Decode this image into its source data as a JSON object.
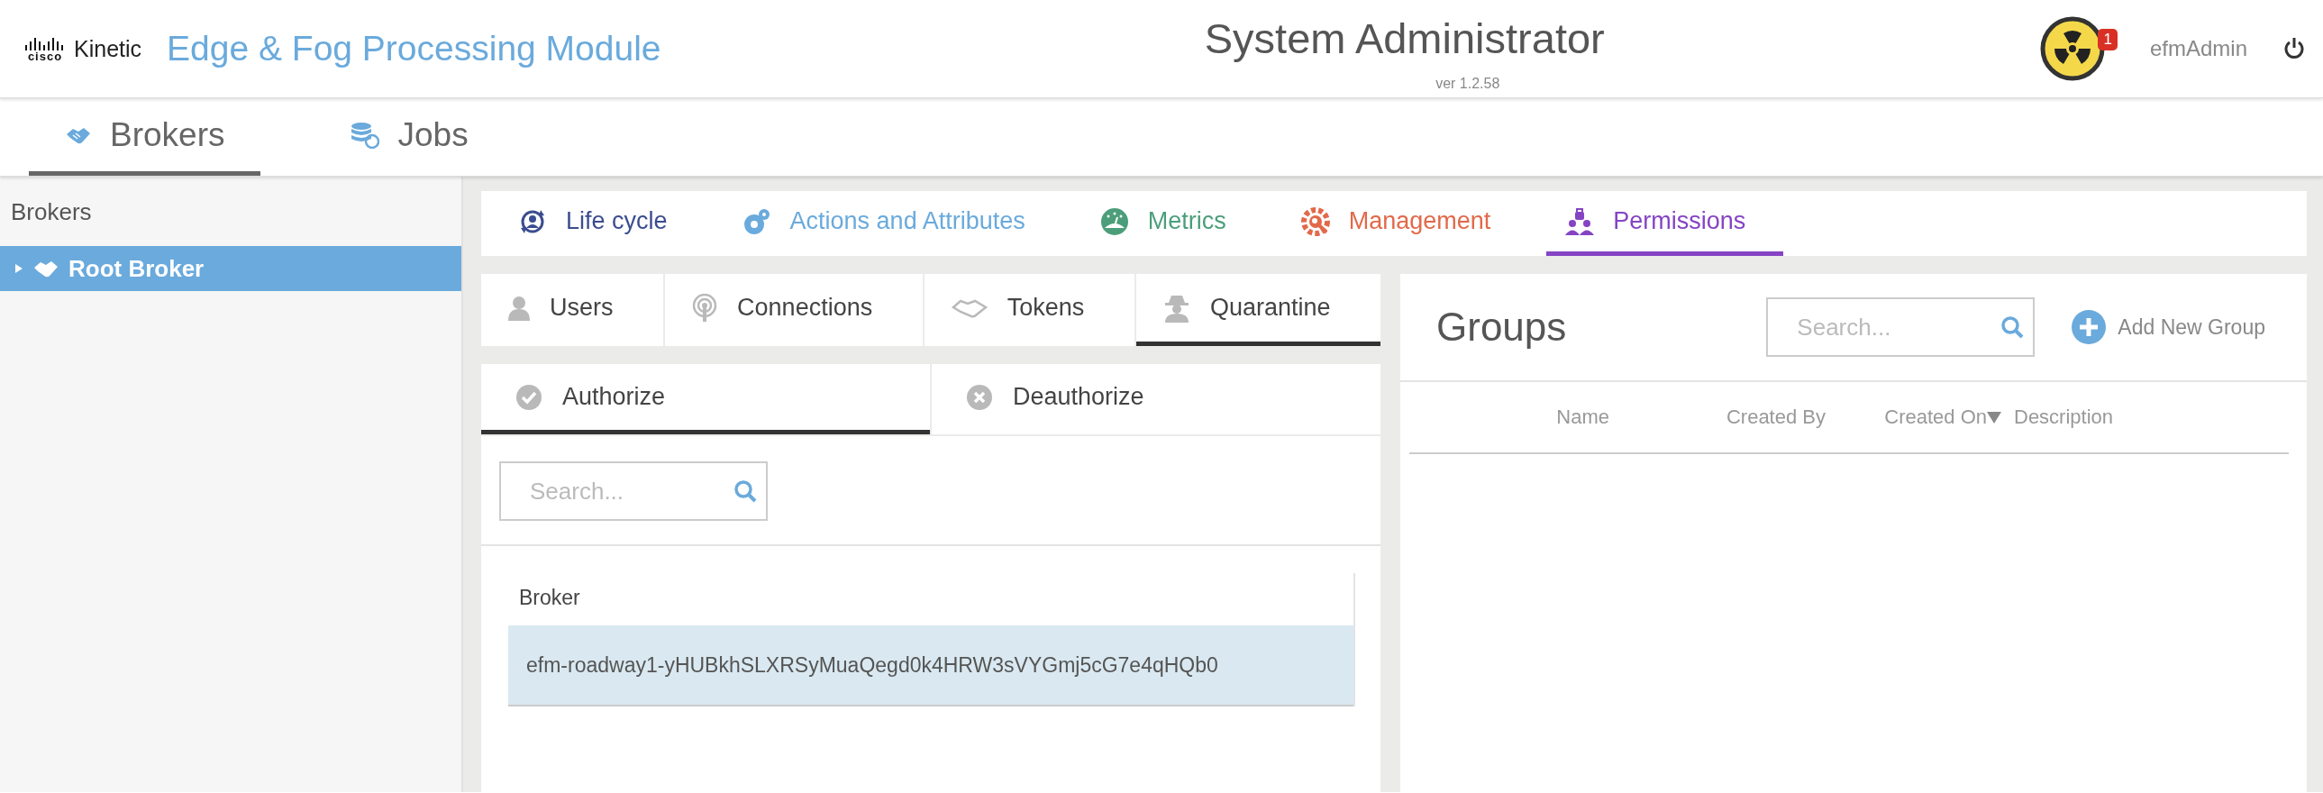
{
  "header": {
    "logo_wordmark": "cisco",
    "logo_text": "Kinetic",
    "app_title": "Edge & Fog Processing Module",
    "page_title": "System Administrator",
    "version": "ver 1.2.58",
    "notification_count": "1",
    "user": "efmAdmin"
  },
  "nav_tabs": [
    {
      "label": "Brokers",
      "selected": true
    },
    {
      "label": "Jobs",
      "selected": false
    }
  ],
  "sidebar": {
    "title": "Brokers",
    "items": [
      {
        "label": "Root Broker",
        "selected": true,
        "expanded": false
      }
    ]
  },
  "section_tabs": [
    {
      "label": "Life cycle",
      "color": "#3b4d8f",
      "selected": false
    },
    {
      "label": "Actions and Attributes",
      "color": "#6aaadc",
      "selected": false
    },
    {
      "label": "Metrics",
      "color": "#4c9e7a",
      "selected": false
    },
    {
      "label": "Management",
      "color": "#e2694a",
      "selected": false
    },
    {
      "label": "Permissions",
      "color": "#8544c4",
      "selected": true
    }
  ],
  "permission_tabs": [
    {
      "label": "Users",
      "selected": false
    },
    {
      "label": "Connections",
      "selected": false
    },
    {
      "label": "Tokens",
      "selected": false
    },
    {
      "label": "Quarantine",
      "selected": true
    }
  ],
  "auth_tabs": [
    {
      "label": "Authorize",
      "selected": true
    },
    {
      "label": "Deauthorize",
      "selected": false
    }
  ],
  "broker_search": {
    "placeholder": "Search..."
  },
  "broker_table": {
    "columns": [
      "Broker"
    ],
    "rows": [
      {
        "cells": [
          "efm-roadway1-yHUBkhSLXRSyMuaQegd0k4HRW3sVYGmj5cG7e4qHQb0"
        ],
        "selected": true
      }
    ]
  },
  "groups": {
    "title": "Groups",
    "search": {
      "placeholder": "Search..."
    },
    "add_button": "Add New Group",
    "columns": [
      {
        "label": "Name",
        "sorted": false
      },
      {
        "label": "Created By",
        "sorted": false
      },
      {
        "label": "Created On",
        "sorted": true
      },
      {
        "label": "Description",
        "sorted": false
      }
    ]
  }
}
